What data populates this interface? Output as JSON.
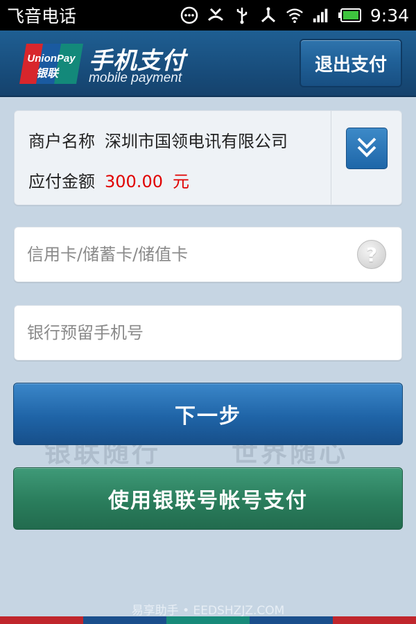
{
  "statusbar": {
    "carrier": "飞音电话",
    "time": "9:34",
    "icons": [
      "message-bubble-icon",
      "missed-call-icon",
      "usb-icon",
      "usb-debug-icon",
      "wifi-icon",
      "signal-icon",
      "battery-icon"
    ]
  },
  "header": {
    "logo_badge_top": "UnionPay",
    "logo_badge_bottom": "银联",
    "title_cn": "手机支付",
    "title_en": "mobile payment",
    "exit_label": "退出支付",
    "colors": {
      "primary": "#1f5f93",
      "dark": "#15426c"
    }
  },
  "merchant": {
    "name_label": "商户名称",
    "name_value": "深圳市国领电讯有限公司",
    "amount_label": "应付金额",
    "amount_value": "300.00",
    "amount_unit": "元",
    "amount_color": "#e00000"
  },
  "inputs": {
    "card_placeholder": "信用卡/储蓄卡/储值卡",
    "card_value": "",
    "phone_placeholder": "银行预留手机号",
    "phone_value": "",
    "help_symbol": "?"
  },
  "watermark": {
    "left": "银联随行",
    "right": "世界随心"
  },
  "buttons": {
    "next_label": "下一步",
    "unionpay_account_label": "使用银联号帐号支付",
    "next_color": "#1f64a7",
    "unionpay_color": "#2a7d5c"
  },
  "footer": {
    "site_watermark": "易享助手 • EEDSHZJZ.COM"
  }
}
